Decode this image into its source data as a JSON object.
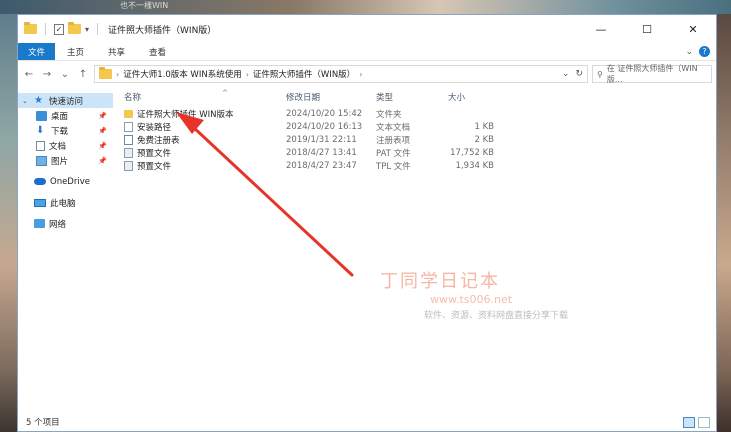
{
  "wallpaper_text": "也不一樣WIN",
  "window": {
    "title": "证件照大师插件（WIN版）"
  },
  "title_controls": {
    "minimize": "—",
    "maximize": "☐",
    "close": "✕"
  },
  "ribbon": {
    "tabs": [
      "文件",
      "主页",
      "共享",
      "查看"
    ]
  },
  "nav": {
    "back": "←",
    "forward": "→",
    "recent": "⌄",
    "up": "↑",
    "breadcrumb": [
      "证件大师1.0版本 WIN系统使用",
      "证件照大师插件（WIN版）"
    ],
    "search_placeholder": "在 证件照大师插件（WIN版... "
  },
  "sidebar": {
    "quick_access": "快速访问",
    "items": [
      {
        "label": "桌面",
        "icon": "desktop-icon",
        "pinned": true
      },
      {
        "label": "下载",
        "icon": "download-icon",
        "pinned": true
      },
      {
        "label": "文档",
        "icon": "document-icon",
        "pinned": true
      },
      {
        "label": "图片",
        "icon": "picture-icon",
        "pinned": true
      }
    ],
    "onedrive": "OneDrive",
    "this_pc": "此电脑",
    "network": "网络"
  },
  "columns": {
    "name": "名称",
    "date": "修改日期",
    "type": "类型",
    "size": "大小"
  },
  "files": [
    {
      "name": "证件照大师插件 WIN版本",
      "date": "2024/10/20 15:42",
      "type": "文件夹",
      "size": "",
      "icon": "folder-icon"
    },
    {
      "name": "安装路径",
      "date": "2024/10/20 16:13",
      "type": "文本文档",
      "size": "1 KB",
      "icon": "text-file-icon"
    },
    {
      "name": "免费注册表",
      "date": "2019/1/31 22:11",
      "type": "注册表项",
      "size": "2 KB",
      "icon": "registry-file-icon"
    },
    {
      "name": "预置文件",
      "date": "2018/4/27 13:41",
      "type": "PAT 文件",
      "size": "17,752 KB",
      "icon": "pat-file-icon"
    },
    {
      "name": "预置文件",
      "date": "2018/4/27 23:47",
      "type": "TPL 文件",
      "size": "1,934 KB",
      "icon": "tpl-file-icon"
    }
  ],
  "watermark": {
    "title": "丁同学日记本",
    "url": "www.ts006.net",
    "subtitle": "软件、资源、资料网盘直接分享下载"
  },
  "status": {
    "count": "5 个项目"
  },
  "colors": {
    "accent": "#1979ca",
    "selection": "#cce4f7",
    "arrow": "#e8332a"
  }
}
